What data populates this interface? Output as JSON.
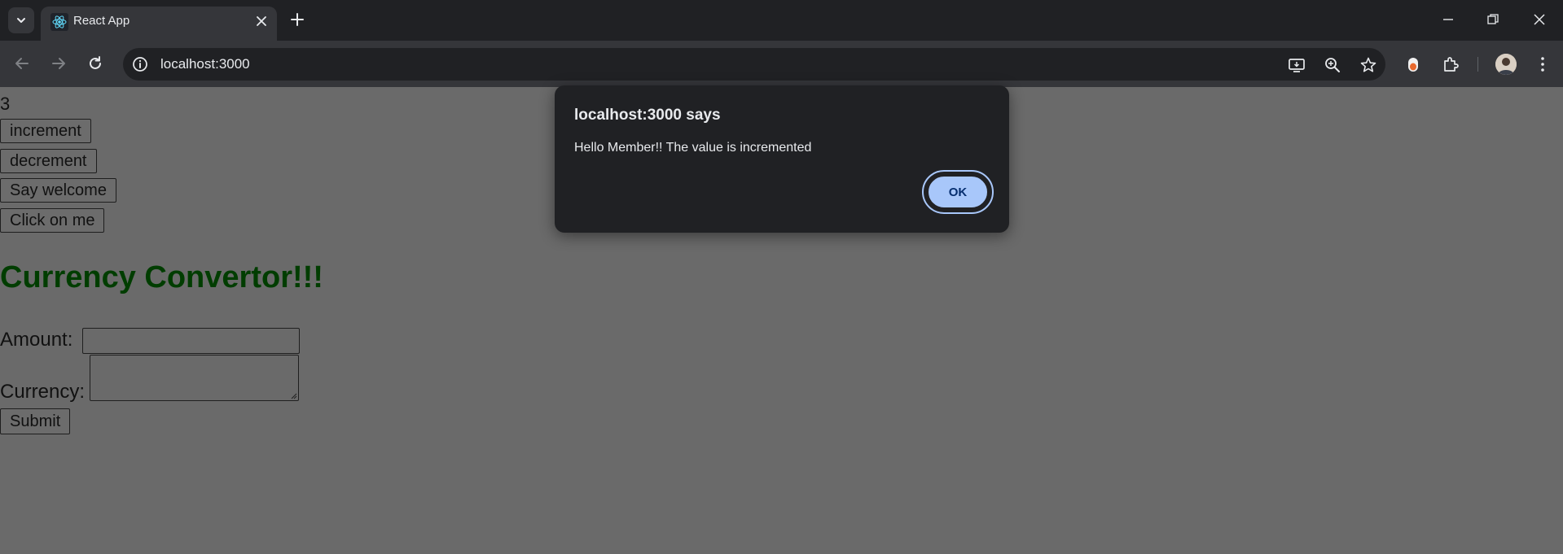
{
  "browser": {
    "tab_title": "React App",
    "url": "localhost:3000"
  },
  "page": {
    "counter_value": "3",
    "buttons": {
      "increment": "increment",
      "decrement": "decrement",
      "say_welcome": "Say welcome",
      "click_on_me": "Click on me"
    },
    "heading": "Currency Convertor!!!",
    "amount_label": "Amount:",
    "currency_label": "Currency:",
    "submit_label": "Submit"
  },
  "dialog": {
    "title": "localhost:3000 says",
    "message": "Hello Member!! The value is incremented",
    "ok_label": "OK"
  },
  "colors": {
    "heading": "#003d00",
    "ok_button": "#a8c7fa",
    "overlay_page": "#6a6a6a"
  }
}
